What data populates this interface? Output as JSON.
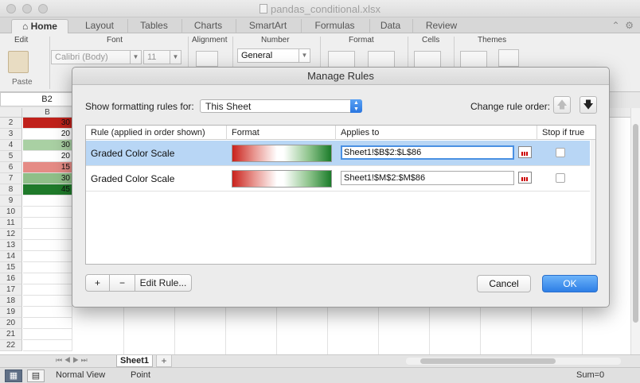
{
  "window": {
    "title": "pandas_conditional.xlsx"
  },
  "ribbon_tabs": [
    "Home",
    "Layout",
    "Tables",
    "Charts",
    "SmartArt",
    "Formulas",
    "Data",
    "Review"
  ],
  "ribbon": {
    "groups": [
      "Edit",
      "Font",
      "Alignment",
      "Number",
      "Format",
      "Cells",
      "Themes"
    ],
    "paste_label": "Paste",
    "font_name": "Calibri (Body)",
    "font_size": "11",
    "number_format": "General"
  },
  "sheet": {
    "name_box": "B2",
    "column_header": "B",
    "rows": [
      {
        "num": "2",
        "value": "30",
        "bg": "#c0211b"
      },
      {
        "num": "3",
        "value": "20",
        "bg": "#ffffff"
      },
      {
        "num": "4",
        "value": "30",
        "bg": "#a9d0a3"
      },
      {
        "num": "5",
        "value": "20",
        "bg": "#ffffff"
      },
      {
        "num": "6",
        "value": "15",
        "bg": "#e58b85"
      },
      {
        "num": "7",
        "value": "30",
        "bg": "#8fbf88"
      },
      {
        "num": "8",
        "value": "45",
        "bg": "#1f7a2a"
      },
      {
        "num": "9",
        "value": ""
      },
      {
        "num": "10",
        "value": ""
      },
      {
        "num": "11",
        "value": ""
      },
      {
        "num": "12",
        "value": ""
      },
      {
        "num": "13",
        "value": ""
      },
      {
        "num": "14",
        "value": ""
      },
      {
        "num": "15",
        "value": ""
      },
      {
        "num": "16",
        "value": ""
      },
      {
        "num": "17",
        "value": ""
      },
      {
        "num": "18",
        "value": ""
      },
      {
        "num": "19",
        "value": ""
      },
      {
        "num": "20",
        "value": ""
      },
      {
        "num": "21",
        "value": ""
      },
      {
        "num": "22",
        "value": ""
      }
    ],
    "tab": "Sheet1",
    "add_tab": "+"
  },
  "status": {
    "view": "Normal View",
    "mode": "Point",
    "sum": "Sum=0"
  },
  "dialog": {
    "title": "Manage Rules",
    "show_for_label": "Show formatting rules for:",
    "show_for_value": "This Sheet",
    "change_order_label": "Change rule order:",
    "columns": [
      "Rule (applied in order shown)",
      "Format",
      "Applies to",
      "Stop if true"
    ],
    "rules": [
      {
        "name": "Graded Color Scale",
        "applies_to": "Sheet1!$B$2:$L$86",
        "selected": true
      },
      {
        "name": "Graded Color Scale",
        "applies_to": "Sheet1!$M$2:$M$86",
        "selected": false
      }
    ],
    "add_label": "+",
    "remove_label": "−",
    "edit_label": "Edit Rule...",
    "cancel_label": "Cancel",
    "ok_label": "OK"
  }
}
